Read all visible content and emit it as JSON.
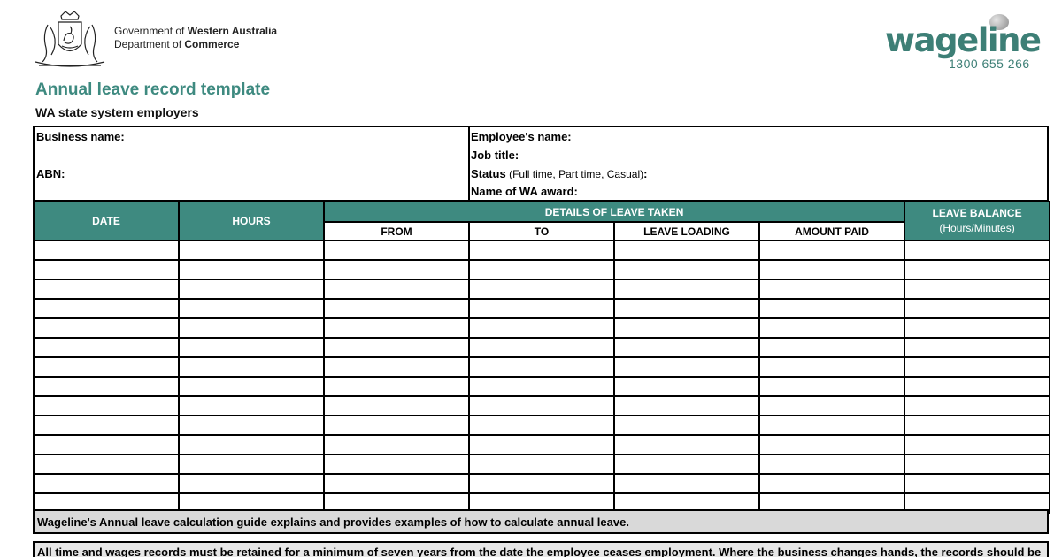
{
  "header": {
    "gov_prefix": "Government of ",
    "gov_name": "Western Australia",
    "dept_prefix": "Department of ",
    "dept_name": "Commerce",
    "brand": "wageline",
    "brand_phone": "1300 655 266"
  },
  "title": "Annual leave record template",
  "subtitle": "WA state system employers",
  "info": {
    "business_name": "Business name:",
    "abn": "ABN:",
    "employee_name": "Employee's name:",
    "job_title": "Job title:",
    "status_label": "Status",
    "status_hint": " (Full time, Part time, Casual)",
    "status_colon": ":",
    "award": "Name of WA award:"
  },
  "table": {
    "date": "DATE",
    "hours": "HOURS",
    "details": "DETAILS OF LEAVE TAKEN",
    "from": "FROM",
    "to": "TO",
    "leave_loading": "LEAVE LOADING",
    "amount_paid": "AMOUNT PAID",
    "leave_balance": "LEAVE BALANCE",
    "leave_balance_unit": "(Hours/Minutes)",
    "row_count": 14
  },
  "note": "Wageline's Annual leave calculation guide explains and provides examples of how to calculate annual leave.",
  "footer": "All time and wages records must be retained for a minimum of seven years from the date the employee ceases employment.  Where the business changes hands, the records should be",
  "colors": {
    "accent": "#3e8a80",
    "note_bg": "#d9d9d9"
  }
}
